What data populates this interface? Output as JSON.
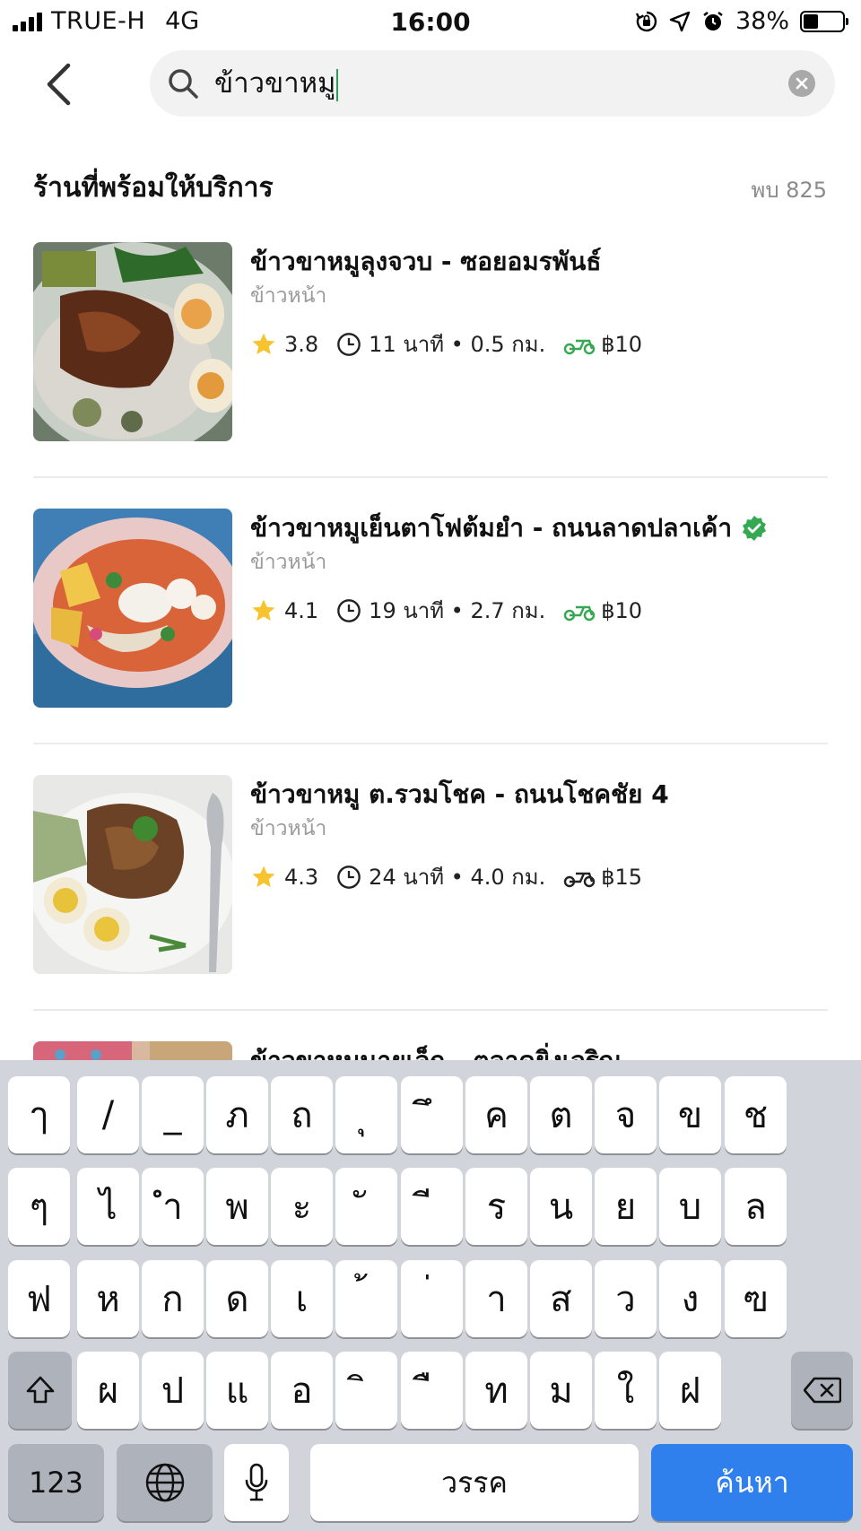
{
  "status_bar": {
    "carrier": "TRUE-H",
    "network": "4G",
    "time": "16:00",
    "battery": "38%",
    "battery_level": 0.38
  },
  "search": {
    "query": "ข้าวขาหมู"
  },
  "section": {
    "title": "ร้านที่พร้อมให้บริการ",
    "count": "พบ 825"
  },
  "restaurants": [
    {
      "name": "ข้าวขาหมูลุงจวบ - ซอยอมรพันธ์",
      "category": "ข้าวหน้า",
      "rating": "3.8",
      "time_distance": "11 นาที • 0.5 กม.",
      "delivery_fee": "฿10",
      "verified": false,
      "delivery_color": "#35a852"
    },
    {
      "name": "ข้าวขาหมูเย็นตาโฟต้มยำ - ถนนลาดปลาเค้า",
      "category": "ข้าวหน้า",
      "rating": "4.1",
      "time_distance": "19 นาที • 2.7 กม.",
      "delivery_fee": "฿10",
      "verified": true,
      "delivery_color": "#35a852"
    },
    {
      "name": "ข้าวขาหมู ต.รวมโชค - ถนนโชคชัย 4",
      "category": "ข้าวหน้า",
      "rating": "4.3",
      "time_distance": "24 นาที • 4.0 กม.",
      "delivery_fee": "฿15",
      "verified": false,
      "delivery_color": "#222222"
    },
    {
      "name": "ข้าวขาหมูนายเล็ก - ตลาดยิ่งเจริญ"
    }
  ],
  "keyboard": {
    "row1": [
      "ๅ",
      "/",
      "_",
      "ภ",
      "ถ",
      "ุ",
      "ึ",
      "ค",
      "ต",
      "จ",
      "ข",
      "ช"
    ],
    "row2": [
      "ๆ",
      "ไ",
      "ำ",
      "พ",
      "ะ",
      "ั",
      "ี",
      "ร",
      "น",
      "ย",
      "บ",
      "ล"
    ],
    "row3": [
      "ฟ",
      "ห",
      "ก",
      "ด",
      "เ",
      "้",
      "่",
      "า",
      "ส",
      "ว",
      "ง",
      "ฃ"
    ],
    "row4": [
      "ผ",
      "ป",
      "แ",
      "อ",
      "ิ",
      "ื",
      "ท",
      "ม",
      "ใ",
      "ฝ"
    ],
    "numbers_label": "123",
    "space_label": "วรรค",
    "search_label": "ค้นหา"
  },
  "colors": {
    "accent_green": "#35a852",
    "star": "#f7c32e",
    "keyboard_bg": "#d1d4da",
    "search_key": "#2f80ed"
  }
}
